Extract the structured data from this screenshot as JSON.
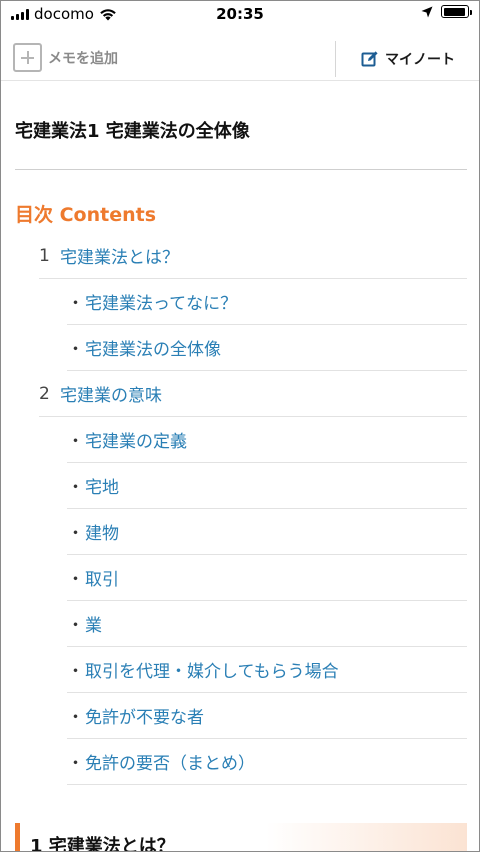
{
  "status_bar": {
    "carrier": "docomo",
    "time": "20:35",
    "battery_level": 0.95
  },
  "toolbar": {
    "memo_label": "メモを追加",
    "my_note_label": "マイノート"
  },
  "article": {
    "title": "宅建業法1 宅建業法の全体像"
  },
  "toc": {
    "heading": "目次 Contents",
    "items": [
      {
        "num": "1",
        "label": "宅建業法とは？"
      },
      {
        "bullet": "・",
        "label": "宅建業法ってなに？"
      },
      {
        "bullet": "・",
        "label": "宅建業法の全体像"
      },
      {
        "num": "2",
        "label": "宅建業の意味"
      },
      {
        "bullet": "・",
        "label": "宅建業の定義"
      },
      {
        "bullet": "・",
        "label": "宅地"
      },
      {
        "bullet": "・",
        "label": "建物"
      },
      {
        "bullet": "・",
        "label": "取引"
      },
      {
        "bullet": "・",
        "label": "業"
      },
      {
        "bullet": "・",
        "label": "取引を代理・媒介してもらう場合"
      },
      {
        "bullet": "・",
        "label": "免許が不要な者"
      },
      {
        "bullet": "・",
        "label": "免許の要否（まとめ）"
      }
    ]
  },
  "section": {
    "heading": "1 宅建業法とは？"
  },
  "colors": {
    "accent": "#ee7a2e",
    "link": "#2a7fb5"
  }
}
